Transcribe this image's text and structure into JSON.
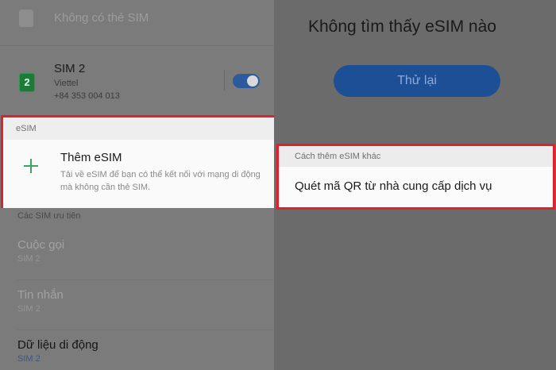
{
  "sim_slots": {
    "sim1": {
      "label": "Không có thẻ SIM"
    },
    "sim2": {
      "slot_badge": "2",
      "name": "SIM 2",
      "carrier": "Viettel",
      "number": "+84 353 004 013",
      "enabled": true
    }
  },
  "esim_section": {
    "header": "eSIM",
    "add_title": "Thêm eSIM",
    "add_description": "Tải về eSIM để bạn có thể kết nối với mạng di động mà không cần thẻ SIM."
  },
  "priority_section": {
    "header": "Các SIM ưu tiên",
    "items": [
      {
        "title": "Cuộc gọi",
        "value": "SIM 2"
      },
      {
        "title": "Tin nhắn",
        "value": "SIM 2"
      },
      {
        "title": "Dữ liệu di động",
        "value": "SIM 2"
      }
    ]
  },
  "right_panel": {
    "not_found_title": "Không tìm thấy eSIM nào",
    "retry_label": "Thử lại",
    "other_methods_header": "Cách thêm eSIM khác",
    "scan_qr_label": "Quét mã QR từ nhà cung cấp dịch vụ"
  },
  "colors": {
    "highlight_border": "#e0202a",
    "accent_blue": "#1d4f97",
    "plus_green": "#3aa564"
  }
}
